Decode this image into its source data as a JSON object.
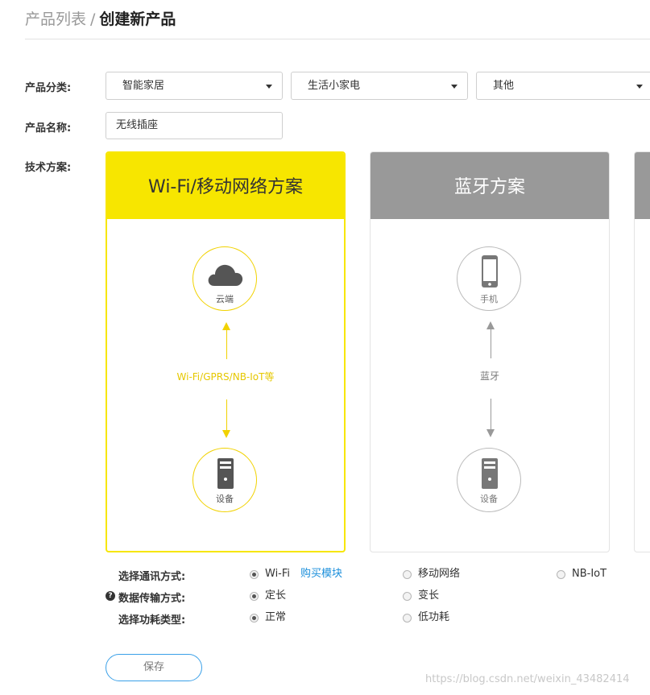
{
  "breadcrumb": {
    "parent": "产品列表",
    "separator": "/",
    "current": "创建新产品"
  },
  "form": {
    "category_label": "产品分类:",
    "category_selects": [
      "智能家居",
      "生活小家电",
      "其他"
    ],
    "name_label": "产品名称:",
    "name_value": "无线插座",
    "tech_label": "技术方案:"
  },
  "schemes": [
    {
      "title": "Wi-Fi/移动网络方案",
      "top_caption": "云端",
      "link_label": "Wi-Fi/GPRS/NB-IoT等",
      "bottom_caption": "设备",
      "selected": true
    },
    {
      "title": "蓝牙方案",
      "top_caption": "手机",
      "link_label": "蓝牙",
      "bottom_caption": "设备",
      "selected": false
    }
  ],
  "options": {
    "comm_label": "选择通讯方式:",
    "comm_options": [
      "Wi-Fi",
      "移动网络",
      "NB-IoT"
    ],
    "buy_module_link": "购买模块",
    "transfer_label": "数据传输方式:",
    "transfer_options": [
      "定长",
      "变长"
    ],
    "power_label": "选择功耗类型:",
    "power_options": [
      "正常",
      "低功耗"
    ]
  },
  "save_label": "保存",
  "watermark": "https://blog.csdn.net/weixin_43482414",
  "colors": {
    "accent_yellow": "#f7e600",
    "gray_header": "#999999",
    "link_blue": "#1b8fdb"
  },
  "icons": [
    "cloud-icon",
    "server-icon",
    "phone-icon",
    "help-icon",
    "caret-down-icon"
  ]
}
